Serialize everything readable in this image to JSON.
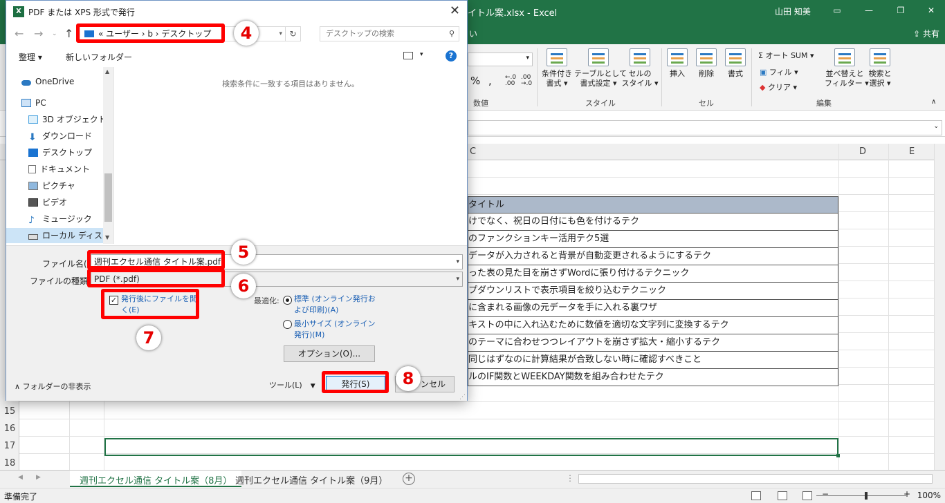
{
  "excel": {
    "title_fragment": "イトル案.xlsx - Excel",
    "user": "山田 知美",
    "share": "共有",
    "tab_fragment": "い",
    "ribbon": {
      "number_group_label": "数値",
      "percent": "%",
      "comma": ",",
      "inc_decimal": "←.0 .00",
      "dec_decimal": ".00 →.0",
      "cond_format": "条件付き\n書式 ▾",
      "format_table": "テーブルとして\n書式設定 ▾",
      "cell_style": "セルの\nスタイル ▾",
      "style_group_label": "スタイル",
      "insert": "挿入",
      "delete": "削除",
      "format": "書式",
      "cell_group_label": "セル",
      "autosum": "Σ オート SUM ▾",
      "fill": "フィル ▾",
      "clear": "クリア ▾",
      "sort_filter": "並べ替えと\nフィルター ▾",
      "find_select": "検索と\n選択 ▾",
      "edit_group_label": "編集"
    },
    "columns": [
      "C",
      "D",
      "E"
    ],
    "rows": [
      "15",
      "16",
      "17",
      "18"
    ],
    "table_header": "タイトル",
    "table_rows": [
      "けでなく、祝日の日付にも色を付けるテク",
      "のファンクションキー活用テク5選",
      "データが入力されると背景が自動変更されるようにするテク",
      "った表の見た目を崩さずWordに張り付けるテクニック",
      "プダウンリストで表示項目を絞り込むテクニック",
      "に含まれる画像の元データを手に入れる裏ワザ",
      "キストの中に入れ込むために数値を適切な文字列に変換するテク",
      "のテーマに合わせつつレイアウトを崩さず拡大・縮小するテク",
      "同じはずなのに計算結果が合致しない時に確認すべきこと",
      "ルのIF関数とWEEKDAY関数を組み合わせたテク"
    ],
    "sheet_tabs": [
      "週刊エクセル通信 タイトル案（8月）",
      "週刊エクセル通信 タイトル案（9月）"
    ],
    "status": "準備完了",
    "zoom": "100%"
  },
  "dialog": {
    "title": "PDF または XPS 形式で発行",
    "excel_icon": "X",
    "address": "«  ユーザー  ›  b  ›  デスクトップ",
    "search_placeholder": "デスクトップの検索",
    "organize": "整理 ▾",
    "new_folder": "新しいフォルダー",
    "help": "?",
    "nav_items": [
      {
        "label": "OneDrive",
        "icon": "cloud-icon"
      },
      {
        "label": "PC",
        "icon": "pc-icon"
      },
      {
        "label": "3D オブジェクト",
        "icon": "cube-icon"
      },
      {
        "label": "ダウンロード",
        "icon": "download-icon"
      },
      {
        "label": "デスクトップ",
        "icon": "desktop-icon"
      },
      {
        "label": "ドキュメント",
        "icon": "document-icon"
      },
      {
        "label": "ピクチャ",
        "icon": "picture-icon"
      },
      {
        "label": "ビデオ",
        "icon": "video-icon"
      },
      {
        "label": "ミュージック",
        "icon": "music-icon"
      },
      {
        "label": "ローカル ディスク (C",
        "icon": "disk-icon"
      }
    ],
    "empty_message": "検索条件に一致する項目はありません。",
    "filename_label": "ファイル名(N):",
    "filename_value": "週刊エクセル通信 タイトル案.pdf",
    "filetype_label": "ファイルの種類(T):",
    "filetype_value": "PDF (*.pdf)",
    "open_after_publish": "発行後にファイルを開く(E)",
    "open_after_checked": true,
    "optimize_label": "最適化:",
    "opt_standard": "標準 (オンライン発行および印刷)(A)",
    "opt_minimum": "最小サイズ (オンライン発行)(M)",
    "options_button": "オプション(O)...",
    "hide_folders": "フォルダーの非表示",
    "tools": "ツール(L)",
    "publish": "発行(S)",
    "cancel": "キャンセル"
  },
  "annotations": [
    "4",
    "5",
    "6",
    "7",
    "8"
  ],
  "colors": {
    "excel_green": "#217346",
    "annotation_red": "#ff0000",
    "table_header_fill": "#acb9ca"
  }
}
